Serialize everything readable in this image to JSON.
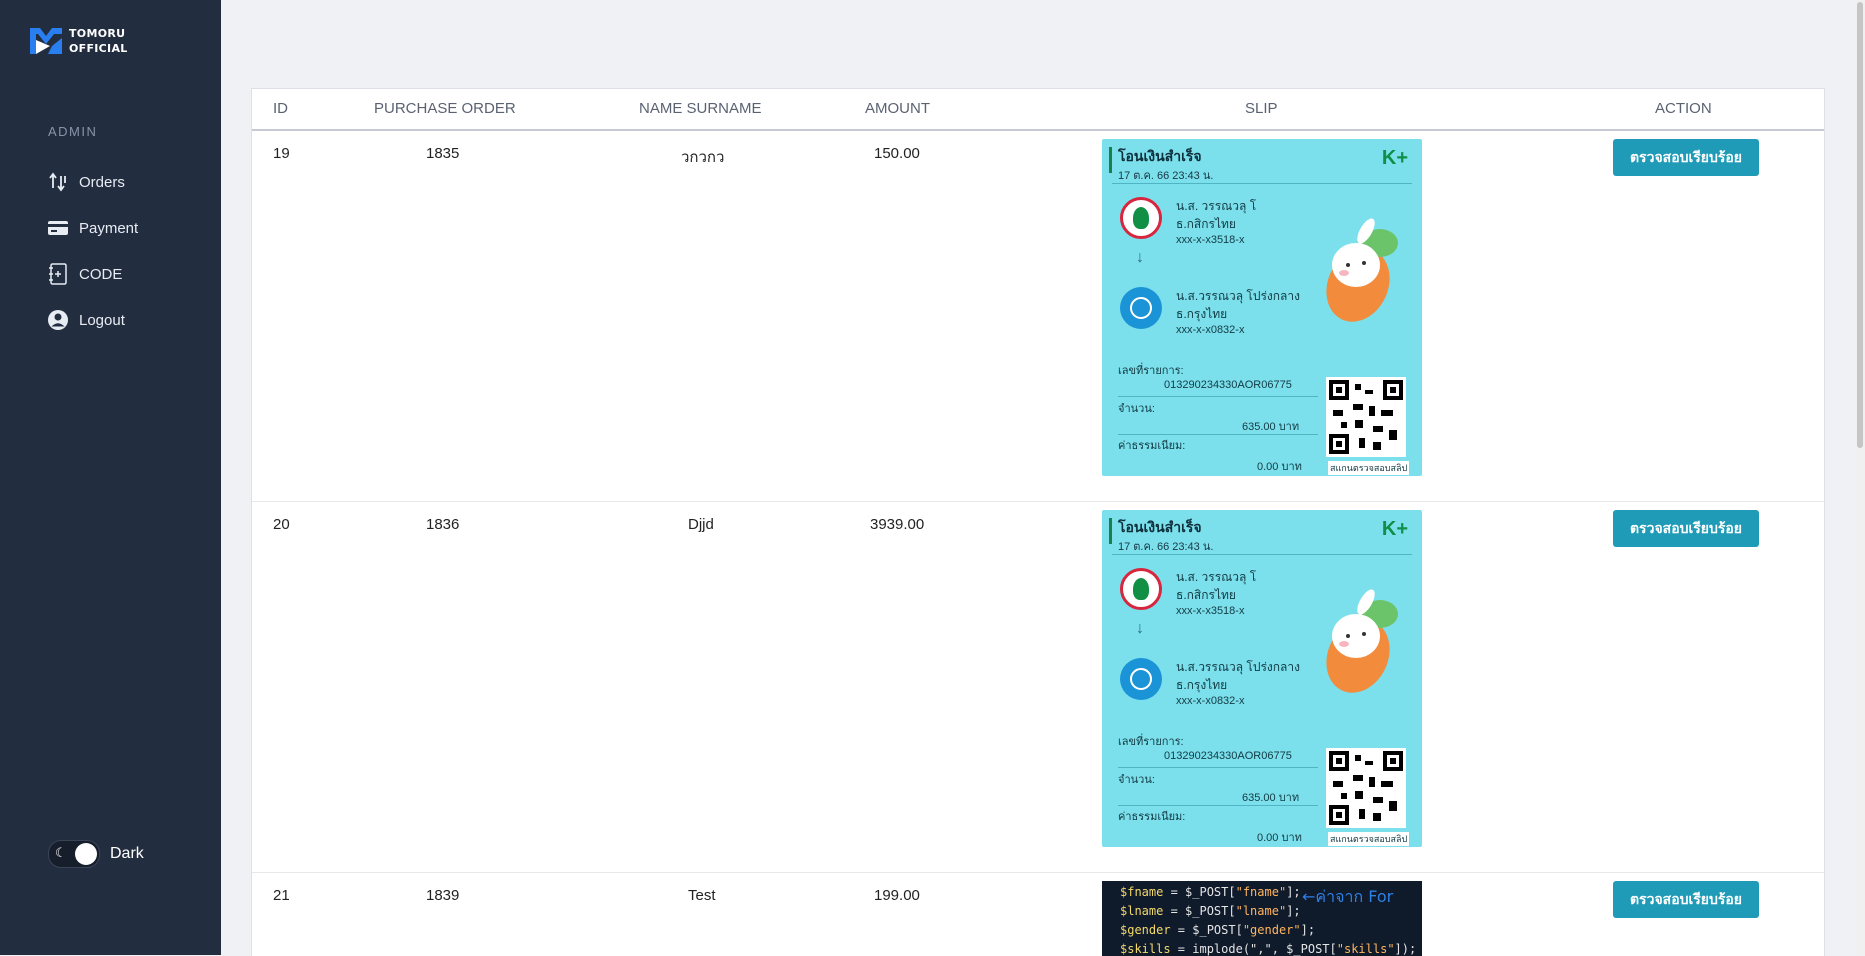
{
  "brand": {
    "line1": "TOMORU",
    "line2": "OFFICIAL"
  },
  "sidebar": {
    "section_label": "ADMIN",
    "items": [
      {
        "label": "Orders",
        "icon": "sort-arrows-icon"
      },
      {
        "label": "Payment",
        "icon": "credit-card-icon"
      },
      {
        "label": "CODE",
        "icon": "code-page-icon"
      },
      {
        "label": "Logout",
        "icon": "user-circle-icon"
      }
    ],
    "theme_toggle": {
      "label": "Dark",
      "icon": "moon-icon",
      "on": true
    }
  },
  "table": {
    "headers": [
      "ID",
      "PURCHASE ORDER",
      "NAME SURNAME",
      "AMOUNT",
      "SLIP",
      "ACTION"
    ],
    "rows": [
      {
        "id": "19",
        "po": "1835",
        "name": "วกวกว",
        "amount": "150.00",
        "action": "ตรวจสอบเรียบร้อย"
      },
      {
        "id": "20",
        "po": "1836",
        "name": "Djjd",
        "amount": "3939.00",
        "action": "ตรวจสอบเรียบร้อย"
      },
      {
        "id": "21",
        "po": "1839",
        "name": "Test",
        "amount": "199.00",
        "action": "ตรวจสอบเรียบร้อย"
      }
    ]
  },
  "slip": {
    "title": "โอนเงินสำเร็จ",
    "date": "17 ต.ค. 66  23:43 น.",
    "brand": "K+",
    "sender_name": "น.ส. วรรณวลุ โ",
    "sender_bank": "ธ.กสิกรไทย",
    "sender_acct": "xxx-x-x3518-x",
    "receiver_name": "น.ส.วรรณวลุ โปร่งกลาง",
    "receiver_bank": "ธ.กรุงไทย",
    "receiver_acct": "xxx-x-x0832-x",
    "ref_label": "เลขที่รายการ:",
    "ref_value": "013290234330AOR06775",
    "amount_label": "จำนวน:",
    "amount_value": "635.00 บาท",
    "fee_label": "ค่าธรรมเนียม:",
    "fee_value": "0.00 บาท",
    "qr_label": "สแกนตรวจสอบสลิป"
  },
  "code_slip": {
    "lines": [
      {
        "var": "$fname",
        "rest": " = $_POST[",
        "key": "\"fname\"",
        "end": "];"
      },
      {
        "var": "$lname",
        "rest": " = $_POST[",
        "key": "\"lname\"",
        "end": "];"
      },
      {
        "var": "$gender",
        "rest": " = $_POST[",
        "key": "\"gender\"",
        "end": "];"
      },
      {
        "var": "$skills",
        "rest": " = implode(\",\", $_POST[",
        "key": "\"skills\"",
        "end": "]);"
      }
    ],
    "handwriting": "←ค่าจาก For"
  },
  "colors": {
    "sidebar": "#232d40",
    "accent": "#1f9bb8",
    "background": "#f0f1f5"
  }
}
